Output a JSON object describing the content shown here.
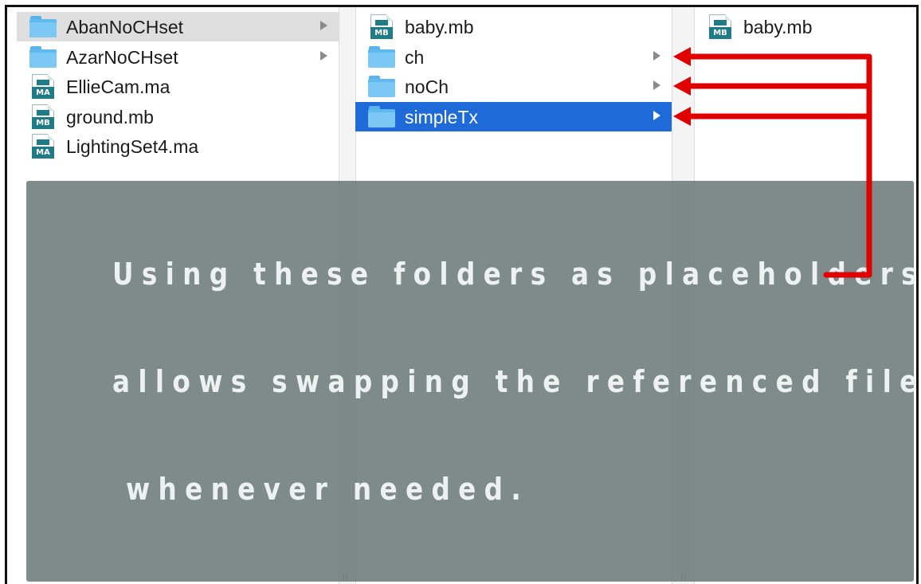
{
  "columns": [
    {
      "items": [
        {
          "label": "AbanNoCHset",
          "icon": "folder-icon",
          "has_chevron": true,
          "selected": "gray"
        },
        {
          "label": "AzarNoCHset",
          "icon": "folder-icon",
          "has_chevron": true,
          "selected": "none"
        },
        {
          "label": "EllieCam.ma",
          "icon": "maya-ascii-file-icon",
          "badge": "MA",
          "has_chevron": false,
          "selected": "none"
        },
        {
          "label": "ground.mb",
          "icon": "maya-binary-file-icon",
          "badge": "MB",
          "has_chevron": false,
          "selected": "none"
        },
        {
          "label": "LightingSet4.ma",
          "icon": "maya-ascii-file-icon",
          "badge": "MA",
          "has_chevron": false,
          "selected": "none"
        }
      ]
    },
    {
      "items": [
        {
          "label": "baby.mb",
          "icon": "maya-binary-file-icon",
          "badge": "MB",
          "has_chevron": false,
          "selected": "none"
        },
        {
          "label": "ch",
          "icon": "folder-icon",
          "has_chevron": true,
          "selected": "none"
        },
        {
          "label": "noCh",
          "icon": "folder-icon",
          "has_chevron": true,
          "selected": "none"
        },
        {
          "label": "simpleTx",
          "icon": "folder-icon",
          "has_chevron": true,
          "selected": "blue"
        }
      ]
    },
    {
      "items": [
        {
          "label": "baby.mb",
          "icon": "maya-binary-file-icon",
          "badge": "MB",
          "has_chevron": false,
          "selected": "none"
        }
      ]
    }
  ],
  "overlay": {
    "line1": "Using these folders as placeholders",
    "line2": "allows swapping the referenced file",
    "line3": "whenever needed."
  },
  "colors": {
    "selection_blue": "#1d6ad8",
    "selection_gray": "#dedede",
    "arrow_red": "#e00000",
    "overlay_gray": "#697676",
    "maya_teal": "#1f7b86",
    "folder_blue": "#5fb8ee"
  }
}
